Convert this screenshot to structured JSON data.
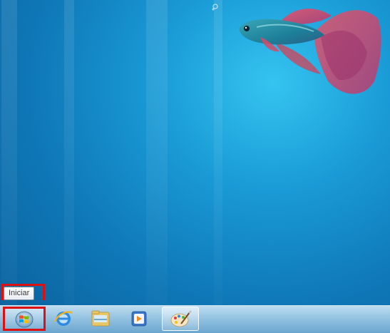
{
  "desktop": {
    "wallpaper": "betta-fish-wallpaper"
  },
  "taskbar": {
    "start_tooltip": "Iniciar",
    "start_icon": "windows-orb-icon",
    "pinned_items": [
      {
        "name": "internet-explorer",
        "icon": "internet-explorer-icon"
      },
      {
        "name": "windows-explorer",
        "icon": "folder-icon"
      },
      {
        "name": "media-player",
        "icon": "media-player-icon"
      },
      {
        "name": "paint",
        "icon": "paint-palette-icon",
        "active": true
      }
    ]
  },
  "colors": {
    "highlight": "#e01010",
    "desktop_blue": "#1a9bd6"
  }
}
